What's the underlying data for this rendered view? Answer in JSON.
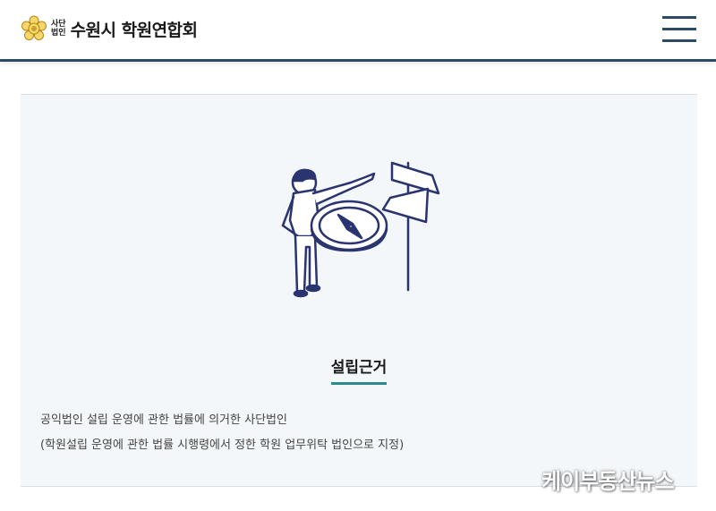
{
  "header": {
    "org_prefix_line1": "사단",
    "org_prefix_line2": "법인",
    "org_name": "수원시 학원연합회",
    "logo_icon": "flower-emblem-icon",
    "menu_icon": "hamburger-menu-icon"
  },
  "content": {
    "illustration": "person-compass-signpost-illustration",
    "title": "설립근거",
    "lines": [
      "공익법인 설립 운영에 관한 법률에 의거한 사단법인",
      "(학원설립 운영에 관한 법률 시행령에서 정한 학원 업무위탁 법인으로 지정)"
    ]
  },
  "watermark": "케이부동산뉴스",
  "colors": {
    "header_border": "#2c4a63",
    "panel_bg": "#f4f7f9",
    "title_underline": "#2b8a8a",
    "illustration_stroke": "#2a3470",
    "logo_gold": "#c9a227"
  }
}
